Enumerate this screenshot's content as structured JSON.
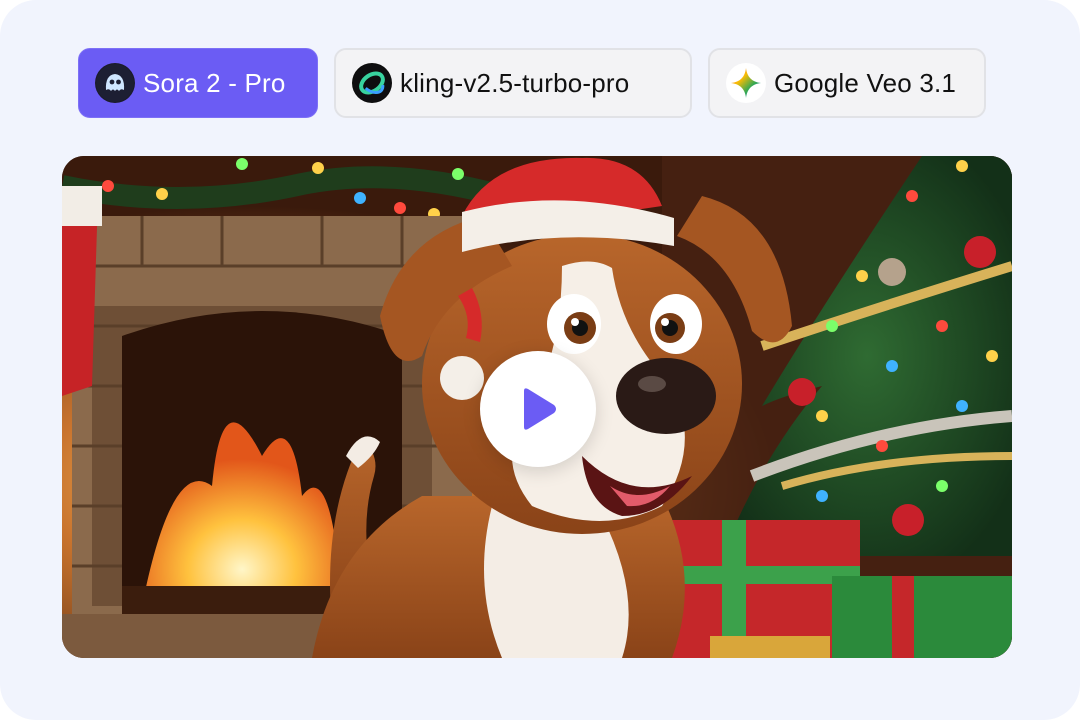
{
  "model_tabs": [
    {
      "label": "Sora 2 - Pro",
      "active": true,
      "icon": "sora-ghost-icon"
    },
    {
      "label": "kling-v2.5-turbo-pro",
      "active": false,
      "icon": "kling-ring-icon"
    },
    {
      "label": "Google Veo 3.1",
      "active": false,
      "icon": "gemini-spark-icon"
    }
  ],
  "video": {
    "thumbnail": "cartoon-dog-santa-hat-fireplace-christmas-tree",
    "play_icon": "play-icon"
  },
  "colors": {
    "accent": "#6b5cf4",
    "background": "#f1f4fd",
    "tab_inactive_bg": "#f3f3f5",
    "tab_border": "#e1e2e6"
  }
}
